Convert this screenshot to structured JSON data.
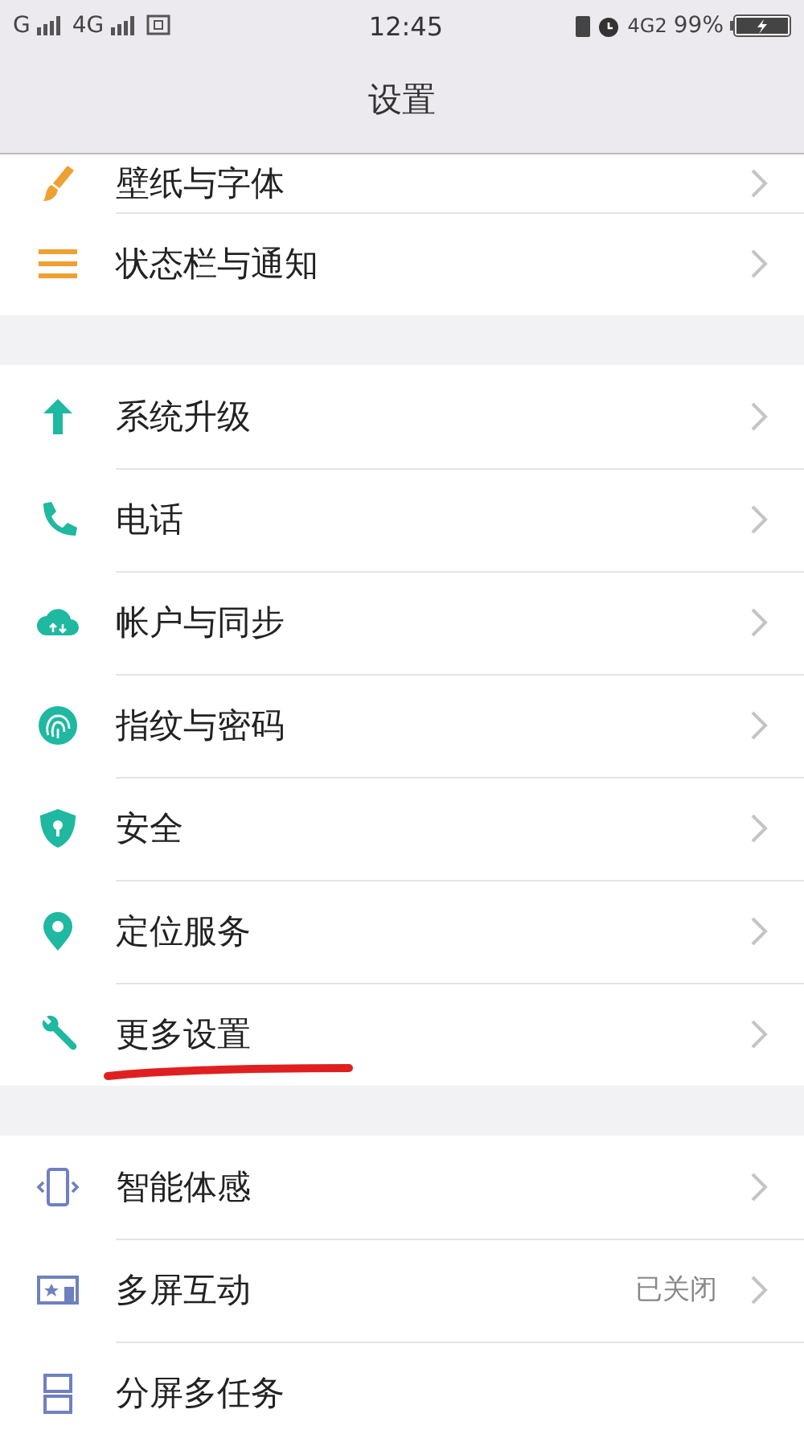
{
  "status_bar": {
    "signal_1": "G",
    "signal_2": "4G",
    "time": "12:45",
    "network": "4G2",
    "battery": "99%"
  },
  "header": {
    "title": "设置"
  },
  "sections": [
    {
      "items": [
        {
          "label": "壁纸与字体",
          "chevron": true,
          "underlined": false
        },
        {
          "label": "状态栏与通知",
          "chevron": true,
          "underlined": false
        }
      ]
    },
    {
      "items": [
        {
          "label": "系统升级",
          "chevron": true,
          "underlined": false
        },
        {
          "label": "电话",
          "chevron": true,
          "underlined": false
        },
        {
          "label": "帐户与同步",
          "chevron": true,
          "underlined": false
        },
        {
          "label": "指纹与密码",
          "chevron": true,
          "underlined": false
        },
        {
          "label": "安全",
          "chevron": true,
          "underlined": false
        },
        {
          "label": "定位服务",
          "chevron": true,
          "underlined": false
        },
        {
          "label": "更多设置",
          "chevron": true,
          "underlined": true
        }
      ]
    },
    {
      "items": [
        {
          "label": "智能体感",
          "chevron": true,
          "underlined": false
        },
        {
          "label": "多屏互动",
          "value": "已关闭",
          "chevron": true,
          "underlined": false
        },
        {
          "label": "分屏多任务",
          "chevron": false,
          "underlined": false
        }
      ]
    }
  ]
}
